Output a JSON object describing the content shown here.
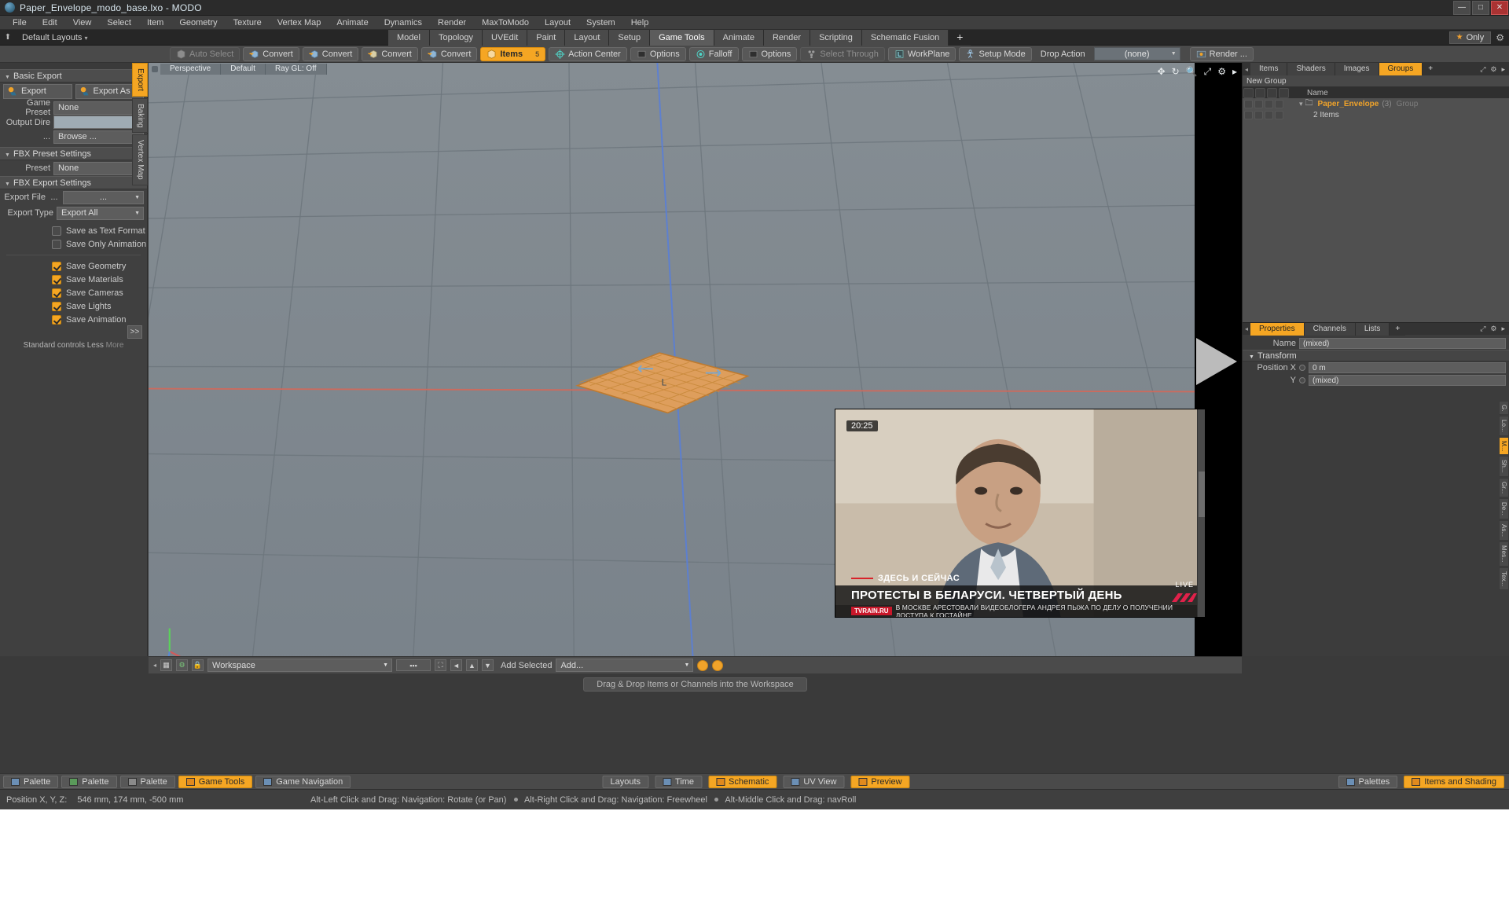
{
  "window": {
    "title": "Paper_Envelope_modo_base.lxo - MODO",
    "logo_icon": "modo-logo-icon",
    "minimize": "—",
    "maximize": "□",
    "close": "✕"
  },
  "menu": {
    "items": [
      "File",
      "Edit",
      "View",
      "Select",
      "Item",
      "Geometry",
      "Texture",
      "Vertex Map",
      "Animate",
      "Dynamics",
      "Render",
      "MaxToModo",
      "Layout",
      "System",
      "Help"
    ]
  },
  "layoutbar": {
    "home_icon": "home-icon",
    "default_layouts": "Default Layouts",
    "caret": "▾",
    "tabs": [
      {
        "label": "Model",
        "active": false
      },
      {
        "label": "Topology",
        "active": false
      },
      {
        "label": "UVEdit",
        "active": false
      },
      {
        "label": "Paint",
        "active": false
      },
      {
        "label": "Layout",
        "active": false
      },
      {
        "label": "Setup",
        "active": false
      },
      {
        "label": "Game Tools",
        "active": true
      },
      {
        "label": "Animate",
        "active": false
      },
      {
        "label": "Render",
        "active": false
      },
      {
        "label": "Scripting",
        "active": false
      },
      {
        "label": "Schematic Fusion",
        "active": false
      }
    ],
    "add_tab": "+",
    "only_label": "Only",
    "star_icon": "star-icon",
    "gear_icon": "gear-icon"
  },
  "toolbar": {
    "buttons": [
      {
        "label": "Auto Select",
        "state": "dim",
        "icon": "cube-gray-icon"
      },
      {
        "label": "Convert",
        "state": "normal",
        "icon": "cube-vertex-icon"
      },
      {
        "label": "Convert",
        "state": "normal",
        "icon": "cube-edge-icon"
      },
      {
        "label": "Convert",
        "state": "normal",
        "icon": "cube-poly-icon"
      },
      {
        "label": "Convert",
        "state": "normal",
        "icon": "cube-item-icon"
      },
      {
        "label": "Items",
        "state": "selected",
        "icon": "cube-orange-icon",
        "badge": "5"
      },
      {
        "label": "Action Center",
        "state": "normal",
        "icon": "crosshair-icon"
      },
      {
        "label": "Options",
        "state": "normal",
        "icon": "square-icon"
      },
      {
        "label": "Falloff",
        "state": "normal",
        "icon": "radial-icon"
      },
      {
        "label": "Options",
        "state": "normal",
        "icon": "square-icon"
      },
      {
        "label": "Select Through",
        "state": "dim",
        "icon": "select-through-icon"
      },
      {
        "label": "WorkPlane",
        "state": "normal",
        "icon": "workplane-icon"
      },
      {
        "label": "Setup Mode",
        "state": "normal",
        "icon": "person-icon"
      },
      {
        "label": "Drop Action",
        "state": "plain",
        "icon": ""
      }
    ],
    "drop_action_value": "(none)",
    "render_label": "Render ...",
    "render_icon": "render-icon"
  },
  "left_panel": {
    "vertical_tabs": [
      {
        "label": "Export",
        "active": true
      },
      {
        "label": "Baking",
        "active": false
      },
      {
        "label": "Vertex Map",
        "active": false
      }
    ],
    "basic_export": {
      "header": "Basic Export",
      "triangle": "▼",
      "export_button": "Export",
      "export_as_button": "Export As ...",
      "export_icon": "export-icon",
      "game_preset_label": "Game Preset",
      "game_preset_value": "None",
      "output_dir_label": "Output Dire ...",
      "output_dir_value": "",
      "browse_button": "Browse ..."
    },
    "fbx_preset_settings": {
      "header": "FBX Preset Settings",
      "triangle": "▼",
      "preset_label": "Preset",
      "preset_value": "None"
    },
    "fbx_export_settings": {
      "header": "FBX Export Settings",
      "triangle": "▼",
      "export_file_label": "Export File",
      "export_file_dots": "...",
      "export_file_value": "...",
      "export_type_label": "Export Type",
      "export_type_value": "Export All",
      "checkboxes": [
        {
          "label": "Save as Text Format",
          "checked": false
        },
        {
          "label": "Save Only Animation",
          "checked": false
        },
        {
          "label": "Save Geometry",
          "checked": true
        },
        {
          "label": "Save Materials",
          "checked": true
        },
        {
          "label": "Save Cameras",
          "checked": true
        },
        {
          "label": "Save Lights",
          "checked": true
        },
        {
          "label": "Save Animation",
          "checked": true
        }
      ]
    },
    "footer": {
      "standard_controls": "Standard controls",
      "less": "Less",
      "more": "More",
      "expand_button": ">>"
    }
  },
  "viewport": {
    "tabs": [
      "Perspective",
      "Default",
      "Ray GL: Off"
    ],
    "icons": [
      "move-icon",
      "rotate-icon",
      "zoom-icon",
      "fit-icon",
      "gear-icon",
      "chevron-right-icon"
    ],
    "play_icon": "play-triangle-icon"
  },
  "workspace_bar": {
    "icons": [
      "grid-icon",
      "gear-green-icon",
      "lock-icon"
    ],
    "workspace_value": "Workspace",
    "align_icon": "align-icon",
    "fit_icon": "fit-icon",
    "left_icon": "◄",
    "up_icon": "▲",
    "down_icon": "▼",
    "add_selected_label": "Add Selected",
    "add_value": "Add...",
    "orb1": "orange-orb-icon",
    "orb2": "orange-orb-icon",
    "dropzone_text": "Drag & Drop Items or Channels into the Workspace"
  },
  "right_panel": {
    "tabs": [
      {
        "label": "Items",
        "active": false
      },
      {
        "label": "Shaders",
        "active": false
      },
      {
        "label": "Images",
        "active": false
      },
      {
        "label": "Groups",
        "active": true
      },
      {
        "label": "+",
        "active": false
      }
    ],
    "new_group_label": "New Group",
    "list_header_name": "Name",
    "rows": [
      {
        "name": "Paper_Envelope",
        "count": "(3)",
        "type": "Group"
      },
      {
        "sub": "2 Items"
      }
    ],
    "props_tabs": [
      {
        "label": "Properties",
        "active": true
      },
      {
        "label": "Channels",
        "active": false
      },
      {
        "label": "Lists",
        "active": false
      },
      {
        "label": "+",
        "active": false
      }
    ],
    "name_label": "Name",
    "name_value": "(mixed)",
    "transform_header": "Transform",
    "transform_triangle": "▼",
    "position_x_label": "Position X",
    "position_x_value": "0 m",
    "position_y_label": "Y",
    "position_y_value": "(mixed)",
    "vertical_tabs": [
      "G.",
      "Lo...",
      "M...",
      "Sh...",
      "Gr...",
      "De...",
      "As...",
      "Mes...",
      "Tex..."
    ]
  },
  "video_overlay": {
    "timestamp": "20:25",
    "kicker": "ЗДЕСЬ И СЕЙЧАС",
    "headline": "ПРОТЕСТЫ В БЕЛАРУСИ. ЧЕТВЕРТЫЙ ДЕНЬ",
    "ticker_logo": "TVRAIN.RU",
    "ticker_text": "В МОСКВЕ АРЕСТОВАЛИ ВИДЕОБЛОГЕРА АНДРЕЯ ПЫЖА ПО ДЕЛУ О ПОЛУЧЕНИИ ДОСТУПА К ГОСТАЙНЕ",
    "live_label": "LIVE"
  },
  "palette_bar": {
    "left_buttons": [
      {
        "label": "Palette",
        "swatch": "sw-blue",
        "active": false
      },
      {
        "label": "Palette",
        "swatch": "sw-green",
        "active": false
      },
      {
        "label": "Palette",
        "swatch": "sw-gray",
        "active": false
      },
      {
        "label": "Game Tools",
        "swatch": "sw-orange",
        "active": true
      },
      {
        "label": "Game Navigation",
        "swatch": "sw-blue",
        "active": false
      }
    ],
    "center_buttons": [
      {
        "label": "Layouts",
        "swatch": "",
        "active": false
      },
      {
        "label": "Time",
        "swatch": "sw-blue",
        "active": false
      },
      {
        "label": "Schematic",
        "swatch": "sw-orange",
        "active": true
      },
      {
        "label": "UV View",
        "swatch": "sw-blue",
        "active": false
      },
      {
        "label": "Preview",
        "swatch": "sw-orange",
        "active": true
      }
    ],
    "right_buttons": [
      {
        "label": "Palettes",
        "swatch": "sw-blue",
        "active": false
      },
      {
        "label": "Items and Shading",
        "swatch": "sw-orange",
        "active": true
      }
    ]
  },
  "status_bar": {
    "position_label": "Position X, Y, Z:",
    "position_value": "546 mm, 174 mm, -500 mm",
    "hint1": "Alt-Left Click and Drag: Navigation: Rotate (or Pan)",
    "hint2": "Alt-Right Click and Drag: Navigation: Freewheel",
    "hint3": "Alt-Middle Click and Drag: navRoll"
  },
  "colors": {
    "accent": "#f5a623",
    "panel": "#404040",
    "viewport": "#7e868c",
    "text": "#c8c8c8"
  }
}
